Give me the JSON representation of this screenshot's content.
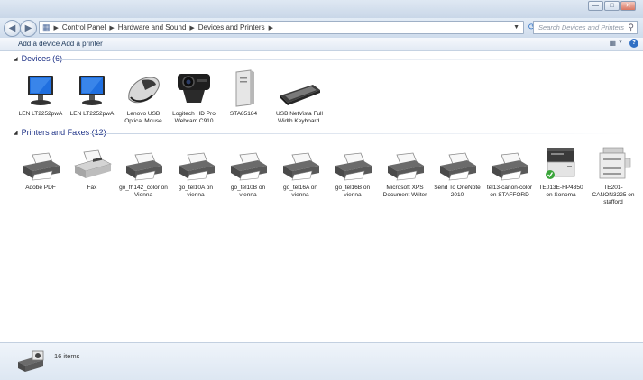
{
  "window": {
    "min_label": "—",
    "max_label": "□",
    "close_label": "✕"
  },
  "nav": {
    "back_icon": "back-arrow-icon",
    "forward_icon": "forward-arrow-icon"
  },
  "address": {
    "breadcrumbs": [
      "Control Panel",
      "Hardware and Sound",
      "Devices and Printers"
    ],
    "search_placeholder": "Search Devices and Printers"
  },
  "commands": {
    "add_device": "Add a device",
    "add_printer": "Add a printer"
  },
  "devices_group": {
    "title": "Devices (6)",
    "items": [
      {
        "label": "LEN LT2252pwA",
        "icon": "monitor-icon"
      },
      {
        "label": "LEN LT2252pwA",
        "icon": "monitor-icon"
      },
      {
        "label": "Lenovo USB Optical Mouse",
        "icon": "mouse-icon"
      },
      {
        "label": "Logitech HD Pro Webcam C910",
        "icon": "webcam-icon"
      },
      {
        "label": "STA85184",
        "icon": "computer-tower-icon"
      },
      {
        "label": "USB NetVista Full Width Keyboard.",
        "icon": "keyboard-icon"
      }
    ]
  },
  "printers_group": {
    "title": "Printers and Faxes (12)",
    "items": [
      {
        "label": "Adobe PDF",
        "icon": "printer-icon"
      },
      {
        "label": "Fax",
        "icon": "fax-icon"
      },
      {
        "label": "go_fh142_color on Vienna",
        "icon": "printer-icon"
      },
      {
        "label": "go_tel10A on vienna",
        "icon": "printer-icon"
      },
      {
        "label": "go_tel10B on vienna",
        "icon": "printer-icon"
      },
      {
        "label": "go_tel16A on vienna",
        "icon": "printer-icon"
      },
      {
        "label": "go_tel16B on vienna",
        "icon": "printer-icon"
      },
      {
        "label": "Microsoft XPS Document Writer",
        "icon": "printer-icon"
      },
      {
        "label": "Send To OneNote 2010",
        "icon": "printer-icon"
      },
      {
        "label": "tel13-canon-color on STAFFORD",
        "icon": "printer-icon"
      },
      {
        "label": "TE013E-HP4350 on Sonoma",
        "icon": "laser-printer-icon",
        "default": true
      },
      {
        "label": "TE201-CANON3225 on stafford",
        "icon": "copier-icon"
      }
    ]
  },
  "status": {
    "count": "16 items"
  },
  "colors": {
    "group_title": "#1e3287",
    "default_check": "#3aa53a"
  }
}
